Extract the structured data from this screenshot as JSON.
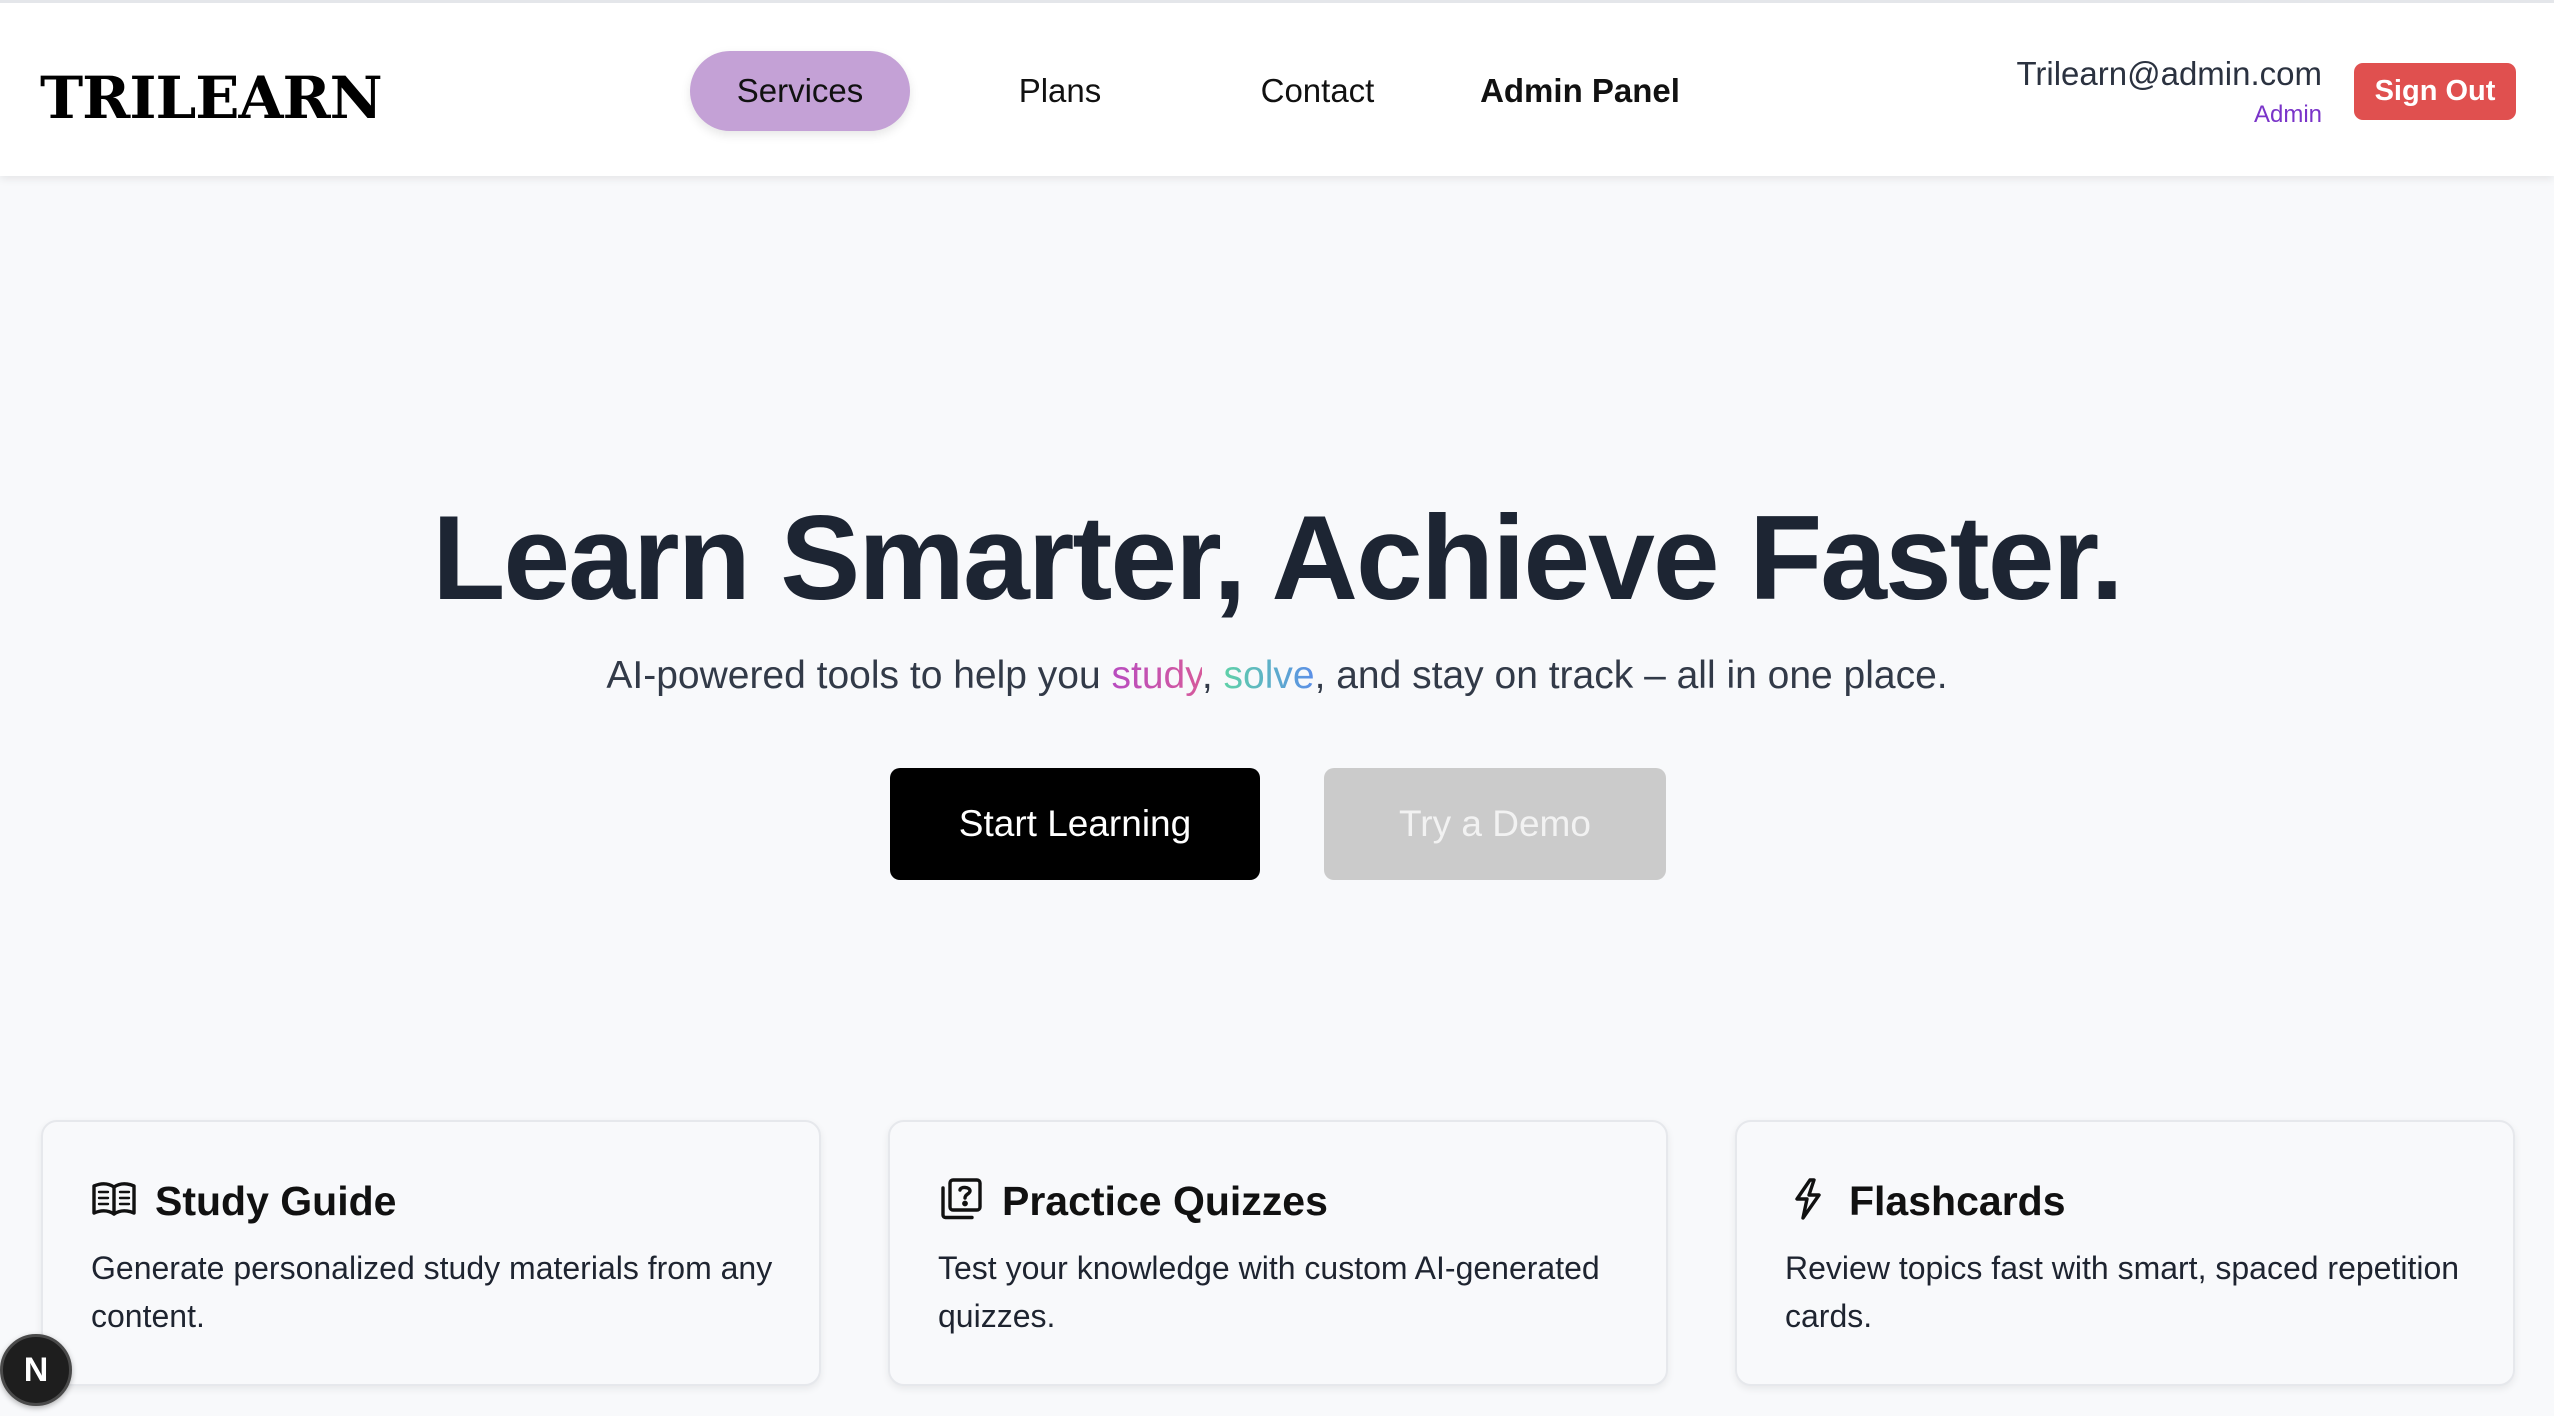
{
  "header": {
    "logo": "TRILEARN",
    "nav": [
      {
        "label": "Services",
        "active": true
      },
      {
        "label": "Plans"
      },
      {
        "label": "Contact"
      },
      {
        "label": "Admin Panel"
      }
    ],
    "user": {
      "email": "Trilearn@admin.com",
      "role": "Admin"
    },
    "sign_out_label": "Sign Out"
  },
  "hero": {
    "title": "Learn Smarter, Achieve Faster.",
    "subtitle_prefix": "AI-powered tools to help you ",
    "subtitle_word1": "study",
    "subtitle_comma": ", ",
    "subtitle_word2": "solve",
    "subtitle_suffix": ", and stay on track – all in one place.",
    "primary_button": "Start Learning",
    "secondary_button": "Try a Demo"
  },
  "features": [
    {
      "icon": "open-book-icon",
      "title": "Study Guide",
      "description": "Generate personalized study materials from any content."
    },
    {
      "icon": "quiz-icon",
      "title": "Practice Quizzes",
      "description": "Test your knowledge with custom AI-generated quizzes."
    },
    {
      "icon": "lightning-icon",
      "title": "Flashcards",
      "description": "Review topics fast with smart, spaced repetition cards."
    }
  ],
  "floating_badge": "N",
  "colors": {
    "nav_active_bg": "#c4a1d6",
    "sign_out_bg": "#e0504f",
    "admin_role": "#7a34c9",
    "primary_button_bg": "#000000",
    "secondary_button_bg": "#cbcbcb"
  }
}
